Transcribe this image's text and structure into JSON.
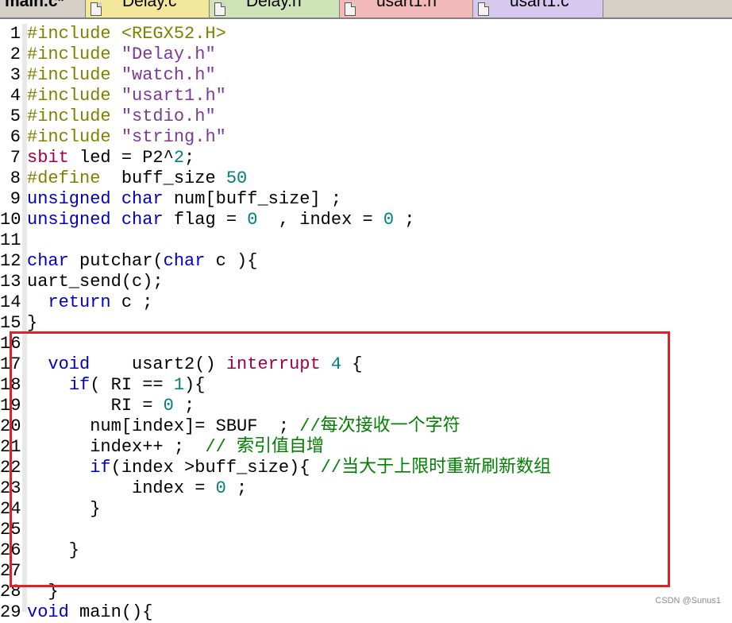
{
  "tabs": [
    {
      "label": "main.c*",
      "active": true,
      "color": "#d4d0c8"
    },
    {
      "label": "Delay.c",
      "active": false,
      "color": "#f3e79b"
    },
    {
      "label": "Delay.h",
      "active": false,
      "color": "#cfe3b8"
    },
    {
      "label": "usart1.h",
      "active": false,
      "color": "#f3b9b9"
    },
    {
      "label": "usart1.c",
      "active": false,
      "color": "#d7c8f0"
    }
  ],
  "lines": [
    {
      "n": "1",
      "segs": [
        {
          "t": "#include <REGX52.H>",
          "c": "pp"
        }
      ]
    },
    {
      "n": "2",
      "segs": [
        {
          "t": "#include ",
          "c": "pp"
        },
        {
          "t": "\"Delay.h\"",
          "c": "str"
        }
      ]
    },
    {
      "n": "3",
      "segs": [
        {
          "t": "#include ",
          "c": "pp"
        },
        {
          "t": "\"watch.h\"",
          "c": "str"
        }
      ]
    },
    {
      "n": "4",
      "segs": [
        {
          "t": "#include ",
          "c": "pp"
        },
        {
          "t": "\"usart1.h\"",
          "c": "str"
        }
      ]
    },
    {
      "n": "5",
      "segs": [
        {
          "t": "#include ",
          "c": "pp"
        },
        {
          "t": "\"stdio.h\"",
          "c": "str"
        }
      ]
    },
    {
      "n": "6",
      "segs": [
        {
          "t": "#include ",
          "c": "pp"
        },
        {
          "t": "\"string.h\"",
          "c": "str"
        }
      ]
    },
    {
      "n": "7",
      "segs": [
        {
          "t": "sbit",
          "c": "mag"
        },
        {
          "t": " led = P2^",
          "c": "op"
        },
        {
          "t": "2",
          "c": "num"
        },
        {
          "t": ";",
          "c": "op"
        }
      ]
    },
    {
      "n": "8",
      "segs": [
        {
          "t": "#define",
          "c": "pp"
        },
        {
          "t": "  buff_size ",
          "c": "op"
        },
        {
          "t": "50",
          "c": "num"
        }
      ]
    },
    {
      "n": "9",
      "segs": [
        {
          "t": "unsigned",
          "c": "kw"
        },
        {
          "t": " ",
          "c": "op"
        },
        {
          "t": "char",
          "c": "kw"
        },
        {
          "t": " num[buff_size] ;",
          "c": "op"
        }
      ]
    },
    {
      "n": "10",
      "segs": [
        {
          "t": "unsigned",
          "c": "kw"
        },
        {
          "t": " ",
          "c": "op"
        },
        {
          "t": "char",
          "c": "kw"
        },
        {
          "t": " flag = ",
          "c": "op"
        },
        {
          "t": "0",
          "c": "num"
        },
        {
          "t": "  , index = ",
          "c": "op"
        },
        {
          "t": "0",
          "c": "num"
        },
        {
          "t": " ;",
          "c": "op"
        }
      ]
    },
    {
      "n": "11",
      "segs": []
    },
    {
      "n": "12",
      "segs": [
        {
          "t": "char",
          "c": "kw"
        },
        {
          "t": " putchar(",
          "c": "op"
        },
        {
          "t": "char",
          "c": "kw"
        },
        {
          "t": " c ){",
          "c": "op"
        }
      ]
    },
    {
      "n": "13",
      "segs": [
        {
          "t": "uart_send(c);",
          "c": "op"
        }
      ]
    },
    {
      "n": "14",
      "segs": [
        {
          "t": "  ",
          "c": "op"
        },
        {
          "t": "return",
          "c": "kw"
        },
        {
          "t": " c ;",
          "c": "op"
        }
      ]
    },
    {
      "n": "15",
      "segs": [
        {
          "t": "}",
          "c": "op"
        }
      ]
    },
    {
      "n": "16",
      "segs": []
    },
    {
      "n": "17",
      "segs": [
        {
          "t": "  ",
          "c": "op"
        },
        {
          "t": "void",
          "c": "kw"
        },
        {
          "t": "    usart2() ",
          "c": "op"
        },
        {
          "t": "interrupt",
          "c": "mag"
        },
        {
          "t": " ",
          "c": "op"
        },
        {
          "t": "4",
          "c": "num"
        },
        {
          "t": " {",
          "c": "op"
        }
      ]
    },
    {
      "n": "18",
      "segs": [
        {
          "t": "    ",
          "c": "op"
        },
        {
          "t": "if",
          "c": "kw"
        },
        {
          "t": "( RI == ",
          "c": "op"
        },
        {
          "t": "1",
          "c": "num"
        },
        {
          "t": "){",
          "c": "op"
        }
      ]
    },
    {
      "n": "19",
      "segs": [
        {
          "t": "        RI = ",
          "c": "op"
        },
        {
          "t": "0",
          "c": "num"
        },
        {
          "t": " ;",
          "c": "op"
        }
      ]
    },
    {
      "n": "20",
      "segs": [
        {
          "t": "      num[index]= SBUF  ; ",
          "c": "op"
        },
        {
          "t": "//每次接收一个字符",
          "c": "cmt"
        }
      ]
    },
    {
      "n": "21",
      "segs": [
        {
          "t": "      index++ ;  ",
          "c": "op"
        },
        {
          "t": "// 索引值自增",
          "c": "cmt"
        }
      ]
    },
    {
      "n": "22",
      "segs": [
        {
          "t": "      ",
          "c": "op"
        },
        {
          "t": "if",
          "c": "kw"
        },
        {
          "t": "(index >buff_size){ ",
          "c": "op"
        },
        {
          "t": "//当大于上限时重新刷新数组",
          "c": "cmt"
        }
      ]
    },
    {
      "n": "23",
      "segs": [
        {
          "t": "          index = ",
          "c": "op"
        },
        {
          "t": "0",
          "c": "num"
        },
        {
          "t": " ;",
          "c": "op"
        }
      ]
    },
    {
      "n": "24",
      "segs": [
        {
          "t": "      }",
          "c": "op"
        }
      ]
    },
    {
      "n": "25",
      "segs": []
    },
    {
      "n": "26",
      "segs": [
        {
          "t": "    }",
          "c": "op"
        }
      ]
    },
    {
      "n": "27",
      "segs": []
    },
    {
      "n": "28",
      "segs": [
        {
          "t": "  }",
          "c": "op"
        }
      ]
    },
    {
      "n": "29",
      "segs": [
        {
          "t": "void",
          "c": "kw"
        },
        {
          "t": " main(){",
          "c": "op"
        }
      ]
    }
  ],
  "watermark": "CSDN @Sunus1"
}
